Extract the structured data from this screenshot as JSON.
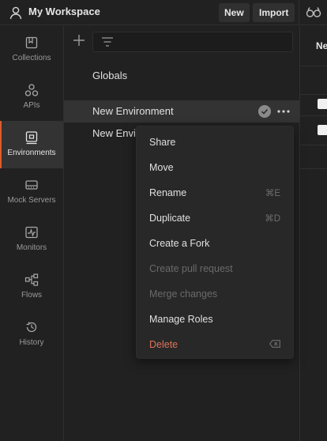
{
  "topbar": {
    "workspace_title": "My Workspace",
    "new_label": "New",
    "import_label": "Import"
  },
  "sidebar": {
    "items": [
      {
        "label": "Collections",
        "icon": "collections-icon",
        "active": false
      },
      {
        "label": "APIs",
        "icon": "apis-icon",
        "active": false
      },
      {
        "label": "Environments",
        "icon": "environments-icon",
        "active": true
      },
      {
        "label": "Mock Servers",
        "icon": "mock-servers-icon",
        "active": false
      },
      {
        "label": "Monitors",
        "icon": "monitors-icon",
        "active": false
      },
      {
        "label": "Flows",
        "icon": "flows-icon",
        "active": false
      },
      {
        "label": "History",
        "icon": "history-icon",
        "active": false
      }
    ]
  },
  "environments": {
    "globals_label": "Globals",
    "items": [
      {
        "label": "New Environment",
        "selected": true
      },
      {
        "label": "New Envi",
        "selected": false
      }
    ]
  },
  "right_pane": {
    "title_fragment": "Ne"
  },
  "context_menu": {
    "items": [
      {
        "label": "Share",
        "shortcut": "",
        "disabled": false
      },
      {
        "label": "Move",
        "shortcut": "",
        "disabled": false
      },
      {
        "label": "Rename",
        "shortcut": "⌘E",
        "disabled": false
      },
      {
        "label": "Duplicate",
        "shortcut": "⌘D",
        "disabled": false
      },
      {
        "label": "Create a Fork",
        "shortcut": "",
        "disabled": false
      },
      {
        "label": "Create pull request",
        "shortcut": "",
        "disabled": true
      },
      {
        "label": "Merge changes",
        "shortcut": "",
        "disabled": true
      },
      {
        "label": "Manage Roles",
        "shortcut": "",
        "disabled": false
      },
      {
        "label": "Delete",
        "shortcut": "backspace-icon",
        "disabled": false,
        "danger": true
      }
    ]
  },
  "colors": {
    "accent": "#e05a2b",
    "danger": "#e0735a",
    "background": "#212121",
    "menu_background": "#282828"
  }
}
